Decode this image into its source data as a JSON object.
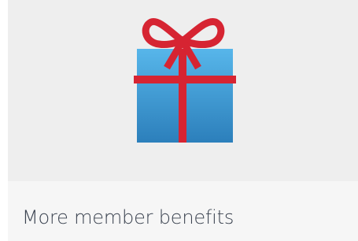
{
  "card": {
    "title": "More member benefits",
    "icon": "gift-icon",
    "colors": {
      "media_background": "#eeeeee",
      "footer_background": "#f6f6f6",
      "box_top": "#4fb0e6",
      "box_bottom": "#2f84c0",
      "ribbon": "#d62432",
      "title_text": "#3b4350"
    }
  }
}
